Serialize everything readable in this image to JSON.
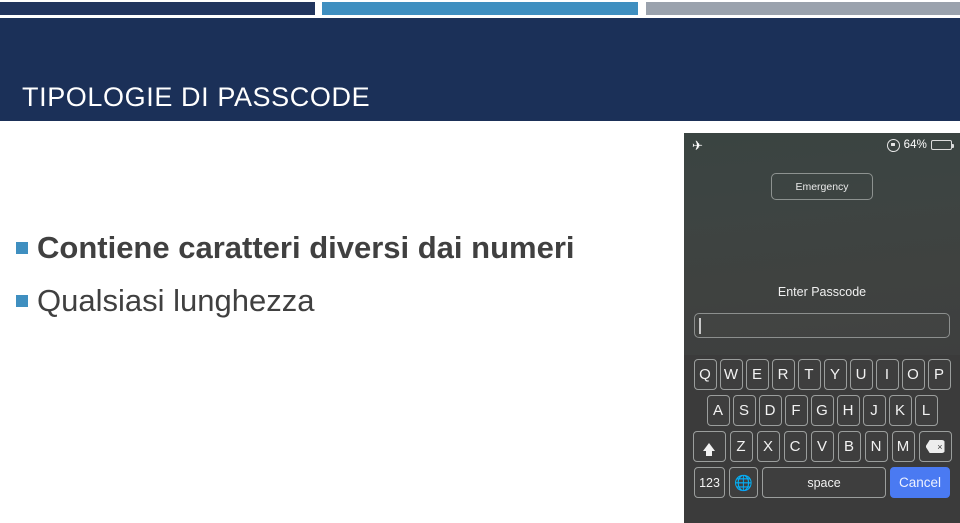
{
  "slide": {
    "title": "TIPOLOGIE DI PASSCODE",
    "deco_colors": {
      "navy": "#1b3058",
      "blue": "#3f8fc0",
      "gray": "#9aa2ad"
    },
    "bullets": [
      {
        "text": "Contiene caratteri diversi dai numeri",
        "style": "bold"
      },
      {
        "text": "Qualsiasi lunghezza",
        "style": "regular"
      }
    ]
  },
  "phone": {
    "status_bar": {
      "airplane_icon": "airplane-mode-icon",
      "rotation_lock_icon": "rotation-lock-icon",
      "battery_percent": "64%",
      "battery_icon": "battery-icon"
    },
    "emergency_label": "Emergency",
    "passcode_prompt": "Enter Passcode",
    "passcode_value": "",
    "keyboard": {
      "row1": [
        "Q",
        "W",
        "E",
        "R",
        "T",
        "Y",
        "U",
        "I",
        "O",
        "P"
      ],
      "row2": [
        "A",
        "S",
        "D",
        "F",
        "G",
        "H",
        "J",
        "K",
        "L"
      ],
      "row3_letters": [
        "Z",
        "X",
        "C",
        "V",
        "B",
        "N",
        "M"
      ],
      "shift_label": "shift-icon",
      "delete_label": "backspace-icon",
      "numeric_label": "123",
      "globe_label": "globe-icon",
      "space_label": "space",
      "cancel_label": "Cancel",
      "cancel_color": "#4a7af2"
    }
  }
}
